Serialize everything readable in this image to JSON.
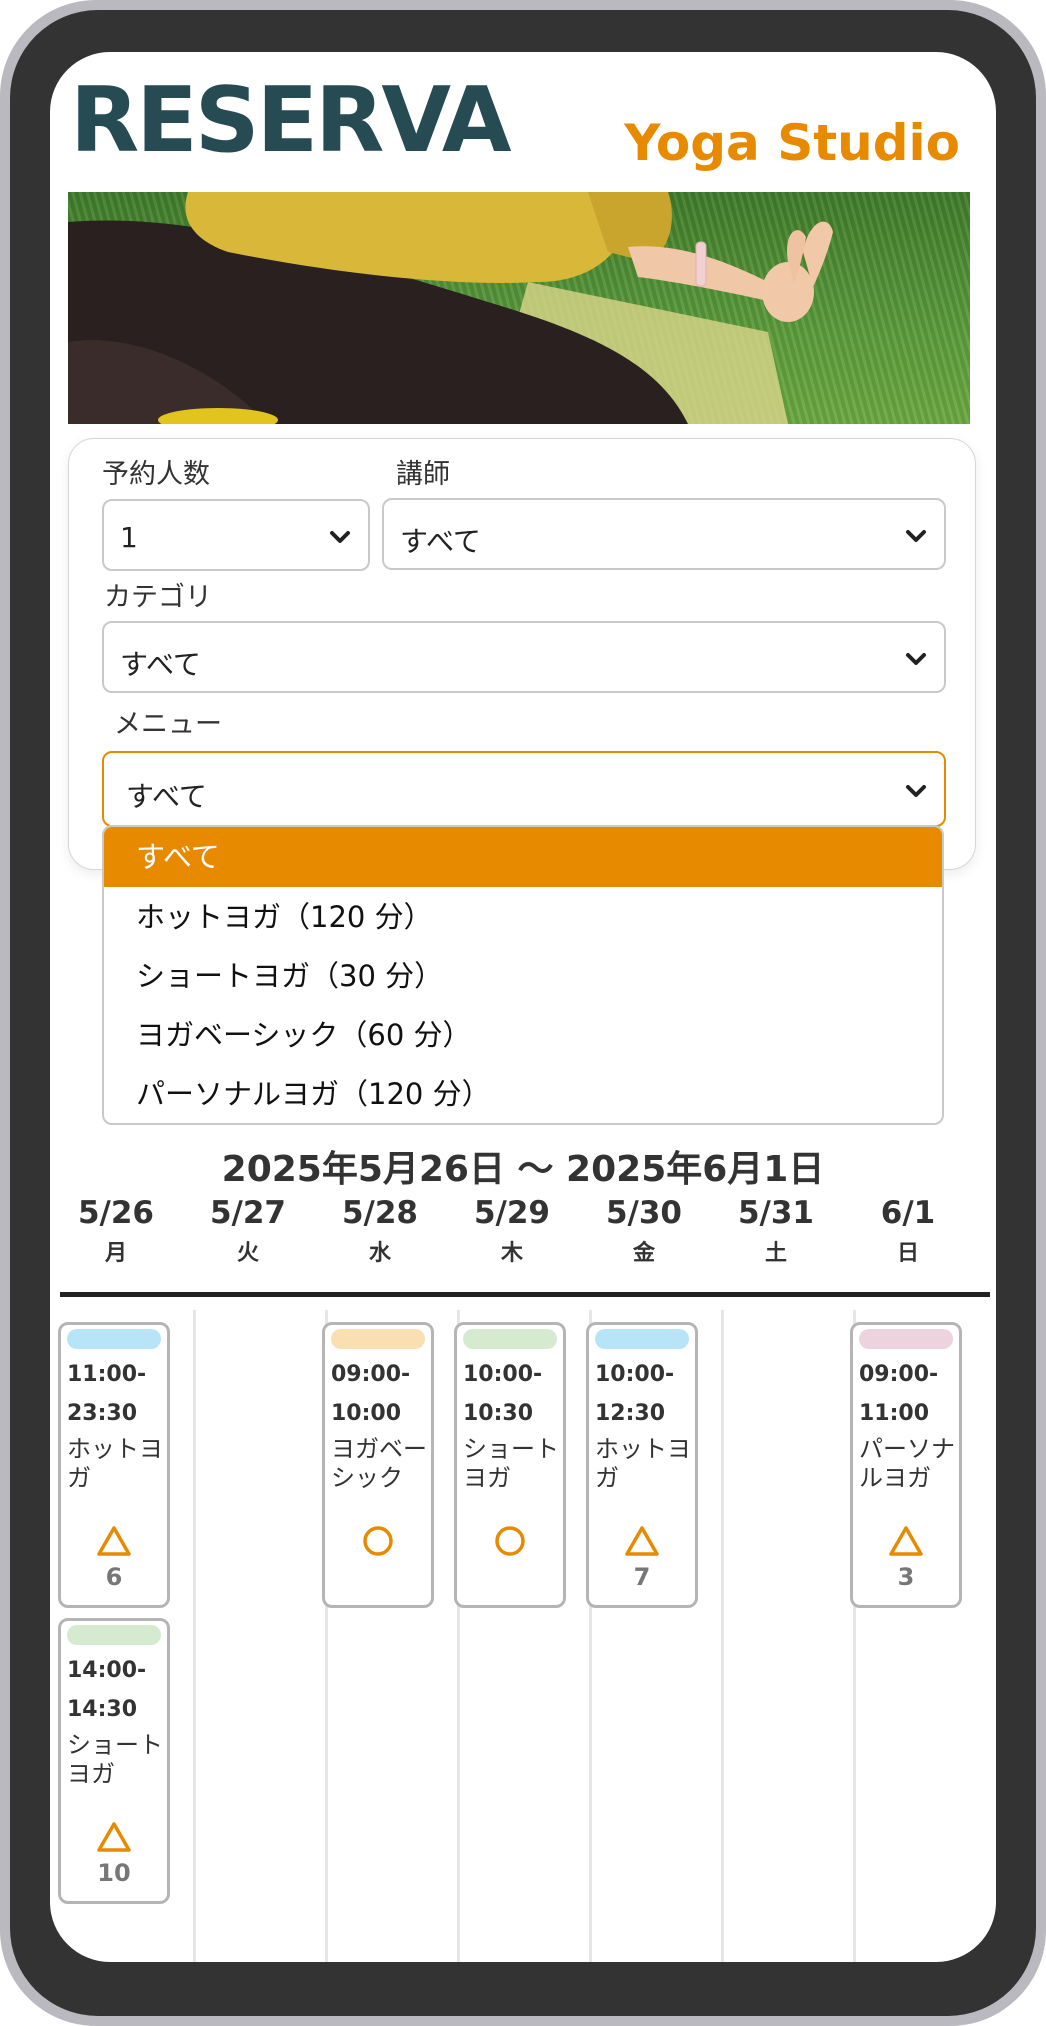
{
  "header": {
    "logo": "RESERVA",
    "subtitle": "Yoga Studio"
  },
  "hero": {
    "image_alt": "person meditating on grass"
  },
  "filters": {
    "party_size": {
      "label": "予約人数",
      "value": "1"
    },
    "instructor": {
      "label": "講師",
      "value": "すべて"
    },
    "category": {
      "label": "カテゴリ",
      "value": "すべて"
    },
    "menu": {
      "label": "メニュー",
      "value": "すべて"
    }
  },
  "menu_dropdown": {
    "options": [
      {
        "label": "すべて",
        "selected": true
      },
      {
        "label": "ホットヨガ（120 分）",
        "selected": false
      },
      {
        "label": "ショートヨガ（30 分）",
        "selected": false
      },
      {
        "label": "ヨガベーシック（60 分）",
        "selected": false
      },
      {
        "label": "パーソナルヨガ（120 分）",
        "selected": false
      }
    ]
  },
  "week": {
    "range": "2025年5月26日 〜 2025年6月1日",
    "days": [
      {
        "date": "5/26",
        "weekday": "月"
      },
      {
        "date": "5/27",
        "weekday": "火"
      },
      {
        "date": "5/28",
        "weekday": "水"
      },
      {
        "date": "5/29",
        "weekday": "木"
      },
      {
        "date": "5/30",
        "weekday": "金"
      },
      {
        "date": "5/31",
        "weekday": "土"
      },
      {
        "date": "6/1",
        "weekday": "日"
      }
    ]
  },
  "slots": [
    {
      "day": "5/26",
      "start": "11:00-",
      "end": "23:30",
      "name": "ホットヨガ",
      "availability": "triangle",
      "remaining": "6",
      "color": "#b8e4f8"
    },
    {
      "day": "5/26",
      "start": "14:00-",
      "end": "14:30",
      "name": "ショートヨガ",
      "availability": "triangle",
      "remaining": "10",
      "color": "#d6ead0"
    },
    {
      "day": "5/28",
      "start": "09:00-",
      "end": "10:00",
      "name": "ヨガベーシック",
      "availability": "circle",
      "remaining": "",
      "color": "#f9dfb2"
    },
    {
      "day": "5/29",
      "start": "10:00-",
      "end": "10:30",
      "name": "ショートヨガ",
      "availability": "circle",
      "remaining": "",
      "color": "#d6ead0"
    },
    {
      "day": "5/30",
      "start": "10:00-",
      "end": "12:30",
      "name": "ホットヨガ",
      "availability": "triangle",
      "remaining": "7",
      "color": "#b8e4f8"
    },
    {
      "day": "6/1",
      "start": "09:00-",
      "end": "11:00",
      "name": "パーソナルヨガ",
      "availability": "triangle",
      "remaining": "3",
      "color": "#ecd3de"
    }
  ],
  "colors": {
    "accent": "#e88a00",
    "logo": "#264b53"
  }
}
